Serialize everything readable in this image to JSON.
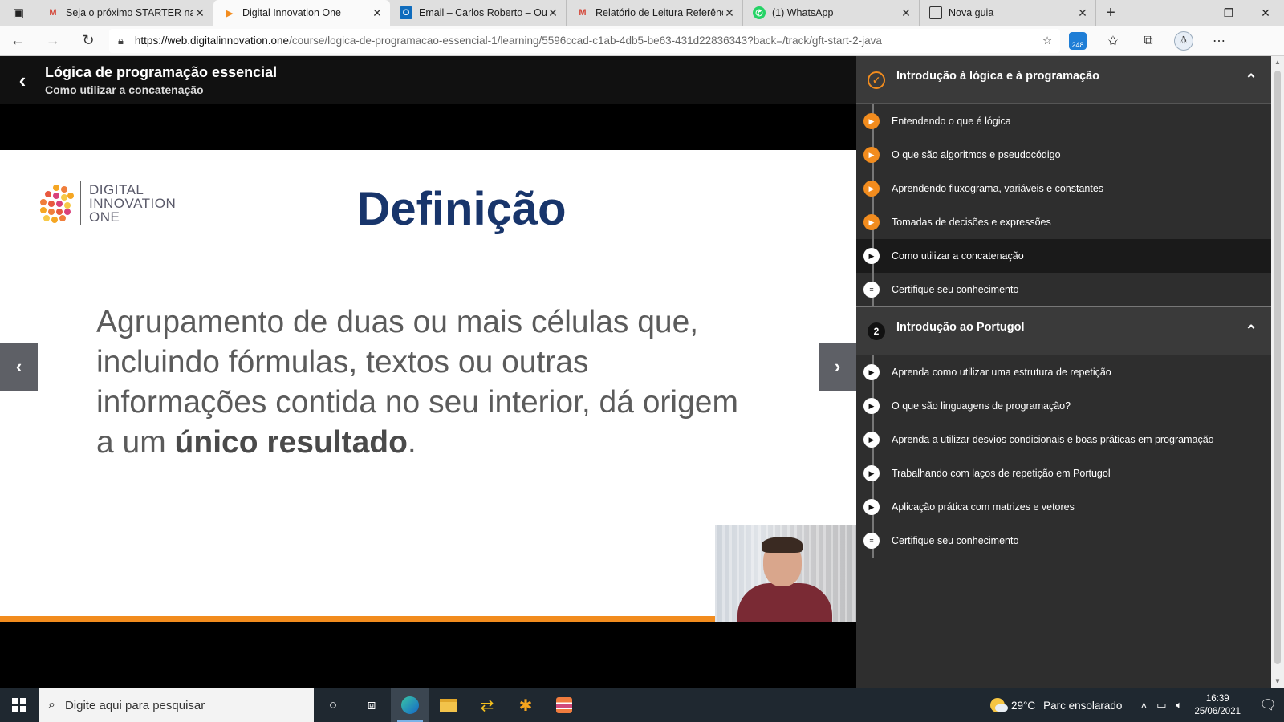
{
  "browser": {
    "tabs": [
      {
        "title": "Seja o próximo STARTER na Gi",
        "favicon": "gmail-icon",
        "active": false
      },
      {
        "title": "Digital Innovation One",
        "favicon": "dio-icon",
        "active": true
      },
      {
        "title": "Email – Carlos Roberto – Outlo",
        "favicon": "outlook-icon",
        "active": false
      },
      {
        "title": "Relatório de Leitura Referênci",
        "favicon": "gmail-icon",
        "active": false
      },
      {
        "title": "(1) WhatsApp",
        "favicon": "whatsapp-icon",
        "active": false
      },
      {
        "title": "Nova guia",
        "favicon": "newtab-icon",
        "active": false
      }
    ],
    "url_domain": "https://web.digitalinnovation.one",
    "url_path": "/course/logica-de-programacao-essencial-1/learning/5596ccad-c1ab-4db5-be63-431d22836343?back=/track/gft-start-2-java",
    "extension_badge": "248"
  },
  "course": {
    "title": "Lógica de programação essencial",
    "current_lesson": "Como utilizar a concatenação"
  },
  "slide": {
    "logo_lines": [
      "DIGITAL",
      "INNOVATION",
      "ONE"
    ],
    "heading": "Definição",
    "body_plain": "Agrupamento de duas ou mais células que, incluindo fórmulas, textos ou outras informações contida no seu interior, dá origem a um ",
    "body_bold": "único resultado",
    "body_end": ".",
    "progress_fraction": 0.835
  },
  "modules": [
    {
      "number": "✓",
      "title": "Introdução à lógica e à programação",
      "completed": true,
      "lessons": [
        {
          "label": "Entendendo o que é lógica",
          "type": "video",
          "done": true,
          "current": false
        },
        {
          "label": "O que são algoritmos e pseudocódigo",
          "type": "video",
          "done": true,
          "current": false
        },
        {
          "label": "Aprendendo fluxograma, variáveis e constantes",
          "type": "video",
          "done": true,
          "current": false
        },
        {
          "label": "Tomadas de decisões e expressões",
          "type": "video",
          "done": true,
          "current": false
        },
        {
          "label": "Como utilizar a concatenação",
          "type": "video",
          "done": false,
          "current": true
        },
        {
          "label": "Certifique seu conhecimento",
          "type": "quiz",
          "done": false,
          "current": false
        }
      ]
    },
    {
      "number": "2",
      "title": "Introdução ao Portugol",
      "completed": false,
      "lessons": [
        {
          "label": "Aprenda como utilizar uma estrutura de repetição",
          "type": "video",
          "done": false,
          "current": false
        },
        {
          "label": "O que são linguagens de programação?",
          "type": "video",
          "done": false,
          "current": false
        },
        {
          "label": "Aprenda a utilizar desvios condicionais e boas práticas em programação",
          "type": "video",
          "done": false,
          "current": false
        },
        {
          "label": "Trabalhando com laços de repetição em Portugol",
          "type": "video",
          "done": false,
          "current": false
        },
        {
          "label": "Aplicação prática com matrizes e vetores",
          "type": "video",
          "done": false,
          "current": false
        },
        {
          "label": "Certifique seu conhecimento",
          "type": "quiz",
          "done": false,
          "current": false
        }
      ]
    }
  ],
  "taskbar": {
    "search_placeholder": "Digite aqui para pesquisar",
    "weather_temp": "29°C",
    "weather_text": "Parc ensolarado",
    "time": "16:39",
    "date": "25/06/2021"
  },
  "colors": {
    "accent_orange": "#f28c1e",
    "heading_blue": "#18356b",
    "sidebar_bg": "#2e2e2e"
  }
}
